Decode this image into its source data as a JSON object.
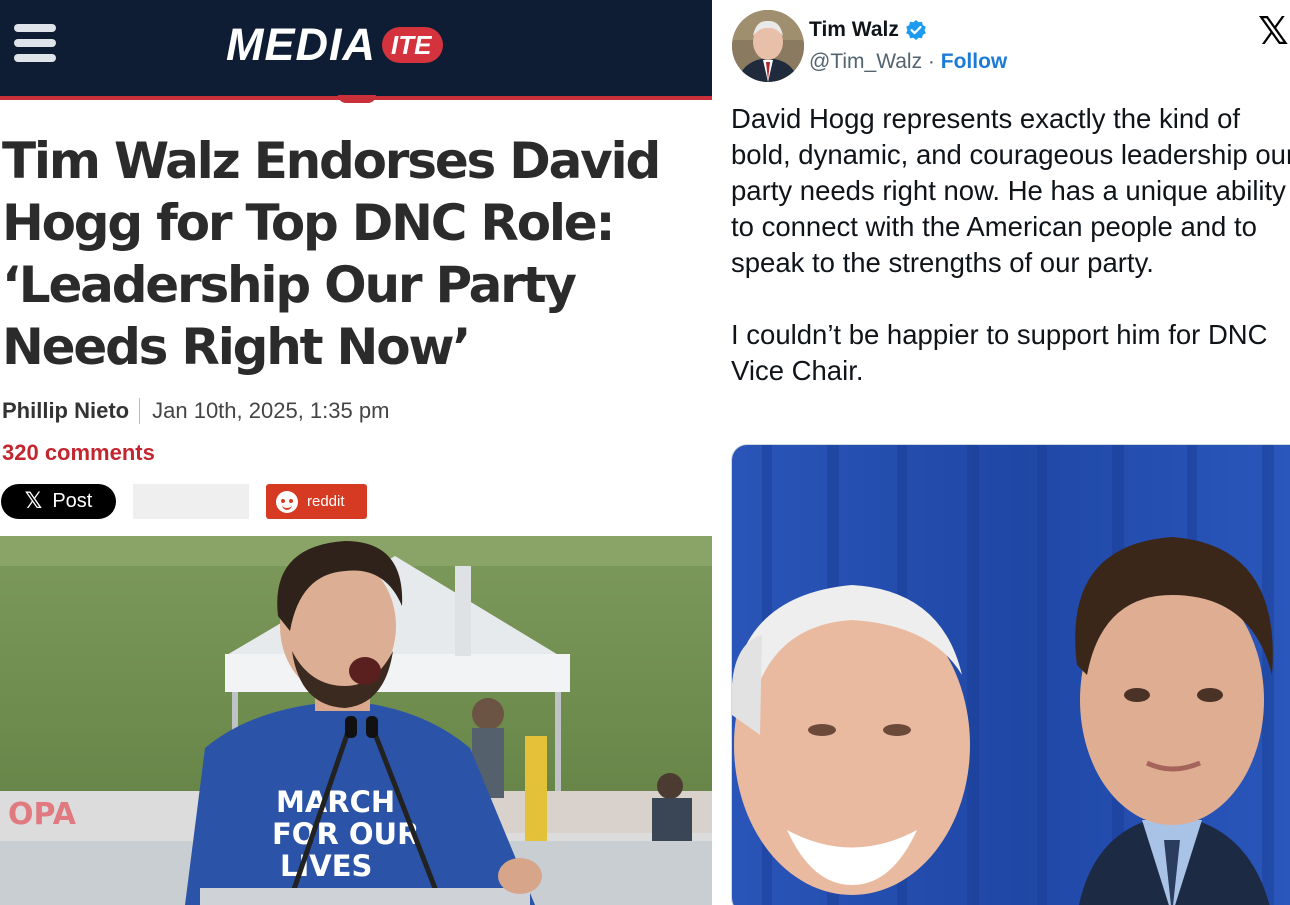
{
  "article": {
    "brand": {
      "main": "MEDIA",
      "pill": "ITE"
    },
    "headline": "Tim Walz Endorses David Hogg for Top DNC Role: ‘Leadership Our Party Needs Right Now’",
    "author": "Phillip Nieto",
    "date": "Jan 10th, 2025, 1:35 pm",
    "comments": "320 comments",
    "share": {
      "x_post": "Post",
      "reddit": "reddit"
    },
    "photo": {
      "shirt_text": [
        "MARCH",
        "FOR OUR",
        "LIVES"
      ],
      "banner_text": "OPA"
    }
  },
  "tweet": {
    "name": "Tim Walz",
    "handle": "@Tim_Walz",
    "separator": " · ",
    "follow": "Follow",
    "text": "David Hogg represents exactly the kind of bold, dynamic, and courageous leadership our party needs right now. He has a unique ability to connect with the American people and to speak to the strengths of our party.\n\nI couldn’t be happier to support him for DNC Vice Chair."
  },
  "colors": {
    "mediaite_navy": "#0e1d33",
    "mediaite_red": "#c9303a",
    "comments_red": "#c3262f",
    "reddit_orange": "#d73a23",
    "x_follow_blue": "#1d7bd8",
    "verified_blue": "#1d9bf0"
  },
  "icons": [
    "hamburger-menu-icon",
    "x-logo-icon",
    "reddit-alien-icon",
    "verified-badge-icon"
  ]
}
